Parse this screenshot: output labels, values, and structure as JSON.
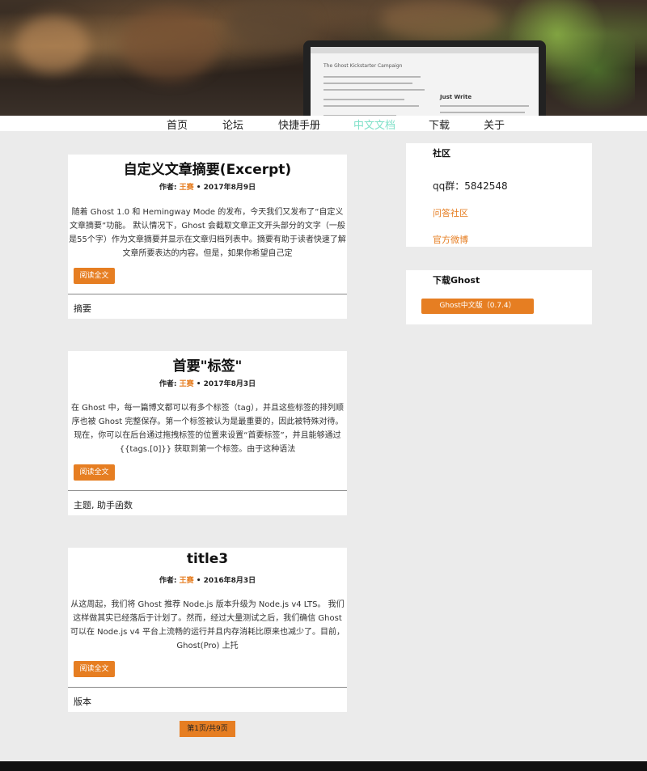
{
  "nav": {
    "items": [
      {
        "label": "首页"
      },
      {
        "label": "论坛"
      },
      {
        "label": "快捷手册"
      },
      {
        "label": "中文文档"
      },
      {
        "label": "下载"
      },
      {
        "label": "关于"
      }
    ],
    "active_color": "#7fe0c8"
  },
  "hero": {
    "screen_doc_title": "The Ghost Kickstarter Campaign",
    "screen_pane_title": "Just Write"
  },
  "posts": [
    {
      "title": "自定义文章摘要(Excerpt)",
      "author_label": "作者:",
      "author": "王赛",
      "date": "• 2017年8月9日",
      "excerpt": "随着 Ghost 1.0 和 Hemingway Mode 的发布，今天我们又发布了“自定义文章摘要”功能。 默认情况下，Ghost 会截取文章正文开头部分的文字（一般是55个字）作为文章摘要并显示在文章归档列表中。摘要有助于读者快速了解文章所要表达的内容。但是，如果你希望自己定",
      "read_more": "阅读全文",
      "tags": "摘要"
    },
    {
      "title": "首要\"标签\"",
      "author_label": "作者:",
      "author": "王赛",
      "date": "• 2017年8月3日",
      "excerpt": "在 Ghost 中，每一篇博文都可以有多个标签（tag），并且这些标签的排列顺序也被 Ghost 完整保存。第一个标签被认为是最重要的，因此被特殊对待。现在，你可以在后台通过拖拽标签的位置来设置“首要标签”，并且能够通过 {{tags.[0]}} 获取到第一个标签。由于这种语法",
      "read_more": "阅读全文",
      "tags": "主题, 助手函数"
    },
    {
      "title": "title3",
      "author_label": "作者:",
      "author": "王赛",
      "date": "• 2016年8月3日",
      "excerpt": "从这周起，我们将 Ghost 推荐 Node.js 版本升级为 Node.js v4 LTS。 我们这样做其实已经落后于计划了。然而，经过大量测试之后，我们确信 Ghost 可以在 Node.js v4 平台上流畅的运行并且内存消耗比原来也减少了。目前，Ghost(Pro) 上托",
      "read_more": "阅读全文",
      "tags": "版本"
    }
  ],
  "pager": {
    "label": "第1页/共9页"
  },
  "sidebar": {
    "community": {
      "title": "社区",
      "qq": "qq群：5842548",
      "links": [
        "问答社区",
        "官方微博"
      ]
    },
    "download": {
      "title": "下载Ghost",
      "button": "Ghost中文版（0.7.4）"
    }
  },
  "colors": {
    "accent": "#e67e22",
    "page_bg": "#ebebeb",
    "footer": "#111111"
  }
}
